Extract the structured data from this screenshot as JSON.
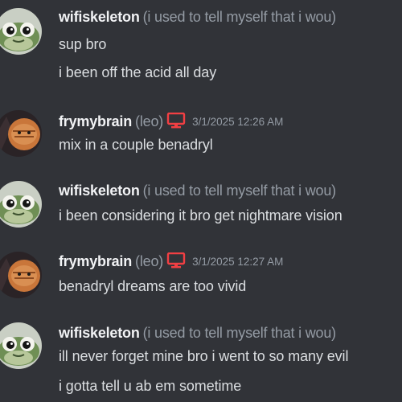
{
  "colors": {
    "background": "#313338",
    "username": "#f2f3f5",
    "muted": "#949ba4",
    "text": "#dbdee1",
    "device_icon": "#f23f43"
  },
  "messages": [
    {
      "username": "wifiskeleton",
      "nickname": "(i used to tell myself that i wou)",
      "timestamp": "",
      "avatar": "frog-avatar",
      "lines": [
        "sup bro",
        "i been off the acid all day"
      ]
    },
    {
      "username": "frymybrain",
      "nickname": "(leo)",
      "device_icon": "desktop-icon",
      "timestamp": "3/1/2025 12:26 AM",
      "avatar": "cat-avatar",
      "lines": [
        "mix in a couple benadryl"
      ]
    },
    {
      "username": "wifiskeleton",
      "nickname": "(i used to tell myself that i wou)",
      "timestamp": "",
      "avatar": "frog-avatar",
      "lines": [
        "i been considering it bro get nightmare vision"
      ]
    },
    {
      "username": "frymybrain",
      "nickname": "(leo)",
      "device_icon": "desktop-icon",
      "timestamp": "3/1/2025 12:27 AM",
      "avatar": "cat-avatar",
      "lines": [
        "benadryl dreams are too vivid"
      ]
    },
    {
      "username": "wifiskeleton",
      "nickname": "(i used to tell myself that i wou)",
      "timestamp": "",
      "avatar": "frog-avatar",
      "lines": [
        "ill never forget mine bro i went to so many evil",
        "i gotta tell u ab em sometime"
      ]
    }
  ]
}
